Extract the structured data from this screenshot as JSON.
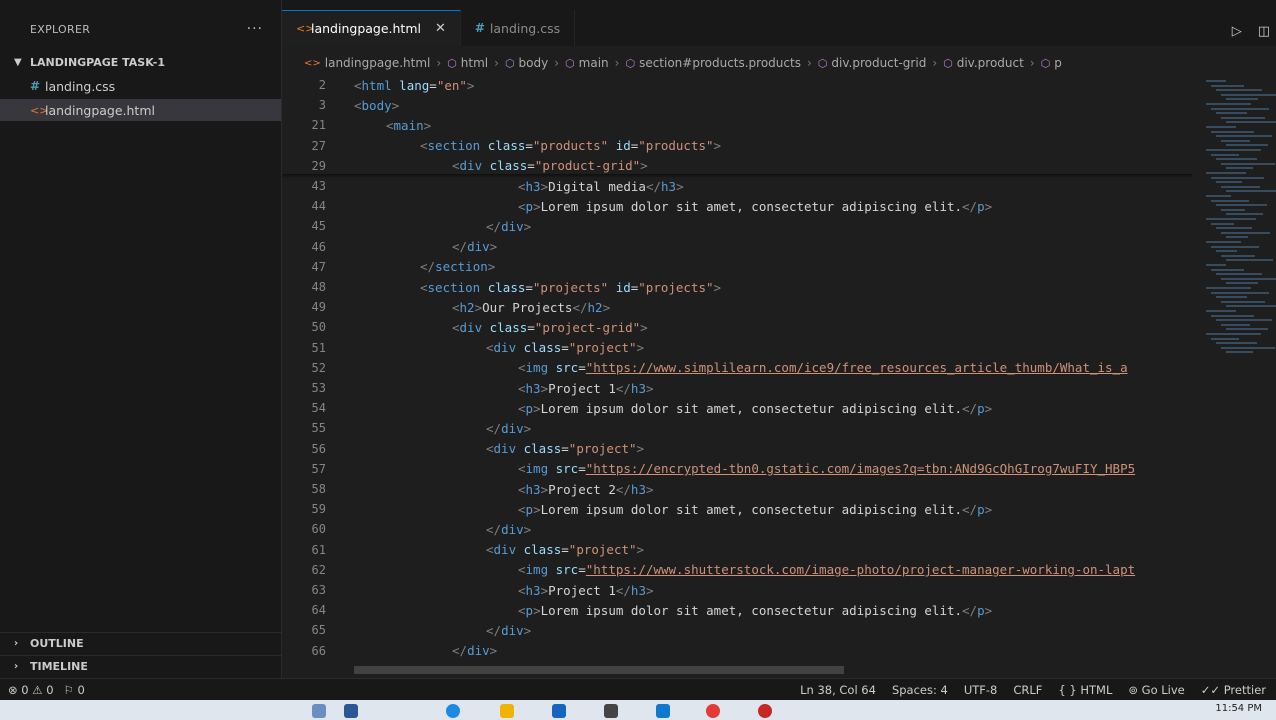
{
  "sidebar": {
    "title": "EXPLORER",
    "more": "···",
    "folder": "LANDINGPAGE TASK-1",
    "files": [
      {
        "name": "landing.css",
        "icon": "#"
      },
      {
        "name": "landingpage.html",
        "icon": "<>"
      }
    ],
    "outline": "OUTLINE",
    "timeline": "TIMELINE"
  },
  "tabs": [
    {
      "label": "landingpage.html",
      "icon": "<>",
      "close": "✕"
    },
    {
      "label": "landing.css",
      "icon": "#"
    }
  ],
  "breadcrumb": [
    "landingpage.html",
    "html",
    "body",
    "main",
    "section#products.products",
    "div.product-grid",
    "div.product",
    "p"
  ],
  "code_lines": [
    {
      "n": "2",
      "parts": [
        [
          "tag",
          "<"
        ],
        [
          "tn",
          "html"
        ],
        [
          "an",
          " lang"
        ],
        [
          "tx",
          "="
        ],
        [
          "av",
          "\"en\""
        ],
        [
          "tag",
          ">"
        ]
      ]
    },
    {
      "n": "3",
      "parts": [
        [
          "tag",
          "<"
        ],
        [
          "tn",
          "body"
        ],
        [
          "tag",
          ">"
        ]
      ]
    },
    {
      "n": "21",
      "parts": [
        [
          "tag",
          "<"
        ],
        [
          "tn",
          "main"
        ],
        [
          "tag",
          ">"
        ]
      ]
    },
    {
      "n": "27",
      "parts": [
        [
          "tag",
          "<"
        ],
        [
          "tn",
          "section"
        ],
        [
          "an",
          " class"
        ],
        [
          "tx",
          "="
        ],
        [
          "av",
          "\"products\""
        ],
        [
          "an",
          " id"
        ],
        [
          "tx",
          "="
        ],
        [
          "av",
          "\"products\""
        ],
        [
          "tag",
          ">"
        ]
      ]
    },
    {
      "n": "29",
      "parts": [
        [
          "tag",
          "<"
        ],
        [
          "tn",
          "div"
        ],
        [
          "an",
          " class"
        ],
        [
          "tx",
          "="
        ],
        [
          "av",
          "\"product-grid\""
        ],
        [
          "tag",
          ">"
        ]
      ]
    },
    {
      "n": "43",
      "parts": [
        [
          "tag",
          "<"
        ],
        [
          "tn",
          "h3"
        ],
        [
          "tag",
          ">"
        ],
        [
          "tx",
          "Digital media"
        ],
        [
          "tag",
          "</"
        ],
        [
          "tn",
          "h3"
        ],
        [
          "tag",
          ">"
        ]
      ]
    },
    {
      "n": "44",
      "parts": [
        [
          "tag",
          "<"
        ],
        [
          "tn",
          "p"
        ],
        [
          "tag",
          ">"
        ],
        [
          "tx",
          "Lorem ipsum dolor sit amet, consectetur adipiscing elit."
        ],
        [
          "tag",
          "</"
        ],
        [
          "tn",
          "p"
        ],
        [
          "tag",
          ">"
        ]
      ]
    },
    {
      "n": "45",
      "parts": [
        [
          "tag",
          "</"
        ],
        [
          "tn",
          "div"
        ],
        [
          "tag",
          ">"
        ]
      ]
    },
    {
      "n": "46",
      "parts": [
        [
          "tag",
          "</"
        ],
        [
          "tn",
          "div"
        ],
        [
          "tag",
          ">"
        ]
      ]
    },
    {
      "n": "47",
      "parts": [
        [
          "tag",
          "</"
        ],
        [
          "tn",
          "section"
        ],
        [
          "tag",
          ">"
        ]
      ]
    },
    {
      "n": "48",
      "parts": [
        [
          "tag",
          "<"
        ],
        [
          "tn",
          "section"
        ],
        [
          "an",
          " class"
        ],
        [
          "tx",
          "="
        ],
        [
          "av",
          "\"projects\""
        ],
        [
          "an",
          " id"
        ],
        [
          "tx",
          "="
        ],
        [
          "av",
          "\"projects\""
        ],
        [
          "tag",
          ">"
        ]
      ]
    },
    {
      "n": "49",
      "parts": [
        [
          "tag",
          "<"
        ],
        [
          "tn",
          "h2"
        ],
        [
          "tag",
          ">"
        ],
        [
          "tx",
          "Our Projects"
        ],
        [
          "tag",
          "</"
        ],
        [
          "tn",
          "h2"
        ],
        [
          "tag",
          ">"
        ]
      ]
    },
    {
      "n": "50",
      "parts": [
        [
          "tag",
          "<"
        ],
        [
          "tn",
          "div"
        ],
        [
          "an",
          " class"
        ],
        [
          "tx",
          "="
        ],
        [
          "av",
          "\"project-grid\""
        ],
        [
          "tag",
          ">"
        ]
      ]
    },
    {
      "n": "51",
      "parts": [
        [
          "tag",
          "<"
        ],
        [
          "tn",
          "div"
        ],
        [
          "an",
          " class"
        ],
        [
          "tx",
          "="
        ],
        [
          "av",
          "\"project\""
        ],
        [
          "tag",
          ">"
        ]
      ]
    },
    {
      "n": "52",
      "parts": [
        [
          "tag",
          "<"
        ],
        [
          "tn",
          "img"
        ],
        [
          "an",
          " src"
        ],
        [
          "tx",
          "="
        ],
        [
          "url",
          "\"https://www.simplilearn.com/ice9/free_resources_article_thumb/What_is_a"
        ]
      ]
    },
    {
      "n": "53",
      "parts": [
        [
          "tag",
          "<"
        ],
        [
          "tn",
          "h3"
        ],
        [
          "tag",
          ">"
        ],
        [
          "tx",
          "Project 1"
        ],
        [
          "tag",
          "</"
        ],
        [
          "tn",
          "h3"
        ],
        [
          "tag",
          ">"
        ]
      ]
    },
    {
      "n": "54",
      "parts": [
        [
          "tag",
          "<"
        ],
        [
          "tn",
          "p"
        ],
        [
          "tag",
          ">"
        ],
        [
          "tx",
          "Lorem ipsum dolor sit amet, consectetur adipiscing elit."
        ],
        [
          "tag",
          "</"
        ],
        [
          "tn",
          "p"
        ],
        [
          "tag",
          ">"
        ]
      ]
    },
    {
      "n": "55",
      "parts": [
        [
          "tag",
          "</"
        ],
        [
          "tn",
          "div"
        ],
        [
          "tag",
          ">"
        ]
      ]
    },
    {
      "n": "56",
      "parts": [
        [
          "tag",
          "<"
        ],
        [
          "tn",
          "div"
        ],
        [
          "an",
          " class"
        ],
        [
          "tx",
          "="
        ],
        [
          "av",
          "\"project\""
        ],
        [
          "tag",
          ">"
        ]
      ]
    },
    {
      "n": "57",
      "parts": [
        [
          "tag",
          "<"
        ],
        [
          "tn",
          "img"
        ],
        [
          "an",
          " src"
        ],
        [
          "tx",
          "="
        ],
        [
          "url",
          "\"https://encrypted-tbn0.gstatic.com/images?q=tbn:ANd9GcQhGIrog7wuFIY_HBP5"
        ]
      ]
    },
    {
      "n": "58",
      "parts": [
        [
          "tag",
          "<"
        ],
        [
          "tn",
          "h3"
        ],
        [
          "tag",
          ">"
        ],
        [
          "tx",
          "Project 2"
        ],
        [
          "tag",
          "</"
        ],
        [
          "tn",
          "h3"
        ],
        [
          "tag",
          ">"
        ]
      ]
    },
    {
      "n": "59",
      "parts": [
        [
          "tag",
          "<"
        ],
        [
          "tn",
          "p"
        ],
        [
          "tag",
          ">"
        ],
        [
          "tx",
          "Lorem ipsum dolor sit amet, consectetur adipiscing elit."
        ],
        [
          "tag",
          "</"
        ],
        [
          "tn",
          "p"
        ],
        [
          "tag",
          ">"
        ]
      ]
    },
    {
      "n": "60",
      "parts": [
        [
          "tag",
          "</"
        ],
        [
          "tn",
          "div"
        ],
        [
          "tag",
          ">"
        ]
      ]
    },
    {
      "n": "61",
      "parts": [
        [
          "tag",
          "<"
        ],
        [
          "tn",
          "div"
        ],
        [
          "an",
          " class"
        ],
        [
          "tx",
          "="
        ],
        [
          "av",
          "\"project\""
        ],
        [
          "tag",
          ">"
        ]
      ]
    },
    {
      "n": "62",
      "parts": [
        [
          "tag",
          "<"
        ],
        [
          "tn",
          "img"
        ],
        [
          "an",
          " src"
        ],
        [
          "tx",
          "="
        ],
        [
          "url",
          "\"https://www.shutterstock.com/image-photo/project-manager-working-on-lapt"
        ]
      ]
    },
    {
      "n": "63",
      "parts": [
        [
          "tag",
          "<"
        ],
        [
          "tn",
          "h3"
        ],
        [
          "tag",
          ">"
        ],
        [
          "tx",
          "Project 1"
        ],
        [
          "tag",
          "</"
        ],
        [
          "tn",
          "h3"
        ],
        [
          "tag",
          ">"
        ]
      ]
    },
    {
      "n": "64",
      "parts": [
        [
          "tag",
          "<"
        ],
        [
          "tn",
          "p"
        ],
        [
          "tag",
          ">"
        ],
        [
          "tx",
          "Lorem ipsum dolor sit amet, consectetur adipiscing elit."
        ],
        [
          "tag",
          "</"
        ],
        [
          "tn",
          "p"
        ],
        [
          "tag",
          ">"
        ]
      ]
    },
    {
      "n": "65",
      "parts": [
        [
          "tag",
          "</"
        ],
        [
          "tn",
          "div"
        ],
        [
          "tag",
          ">"
        ]
      ]
    },
    {
      "n": "66",
      "parts": [
        [
          "tag",
          "</"
        ],
        [
          "tn",
          "div"
        ],
        [
          "tag",
          ">"
        ]
      ]
    }
  ],
  "status": {
    "errors": "⊗ 0 ⚠ 0",
    "ports": "⚐ 0",
    "position": "Ln 38, Col 64",
    "spaces": "Spaces: 4",
    "encoding": "UTF-8",
    "eol": "CRLF",
    "language": "{ } HTML",
    "golive": "⊚ Go Live",
    "prettier": "✓✓ Prettier"
  },
  "taskbar": {
    "time": "11:54 PM"
  },
  "colors": {
    "accent": "#0078d4",
    "editor_bg": "#1e1e1e",
    "sidebar_bg": "#181818"
  },
  "icons": [
    "file-html-icon",
    "file-css-icon",
    "close-icon",
    "run-icon",
    "split-editor-icon",
    "chevron-down-icon",
    "chevron-right-icon",
    "symbol-icon"
  ]
}
